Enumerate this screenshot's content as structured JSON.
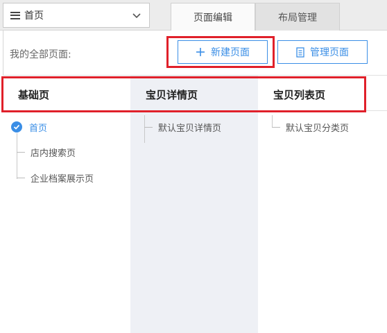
{
  "topbar": {
    "page_select": {
      "value": "首页"
    },
    "tabs": [
      {
        "label": "页面编辑"
      },
      {
        "label": "布局管理"
      }
    ]
  },
  "panel": {
    "pages_label": "我的全部页面:",
    "buttons": {
      "new_page": "新建页面",
      "manage_page": "管理页面"
    },
    "columns": [
      {
        "title": "基础页",
        "items": [
          {
            "label": "首页",
            "selected": true
          },
          {
            "label": "店内搜索页"
          },
          {
            "label": "企业档案展示页"
          }
        ]
      },
      {
        "title": "宝贝详情页",
        "items": [
          {
            "label": "默认宝贝详情页"
          }
        ]
      },
      {
        "title": "宝贝列表页",
        "items": [
          {
            "label": "默认宝贝分类页"
          }
        ]
      }
    ]
  },
  "colors": {
    "accent": "#3a8ee6",
    "highlight_box": "#e0202a",
    "column_alt_bg": "#eef0f5"
  }
}
